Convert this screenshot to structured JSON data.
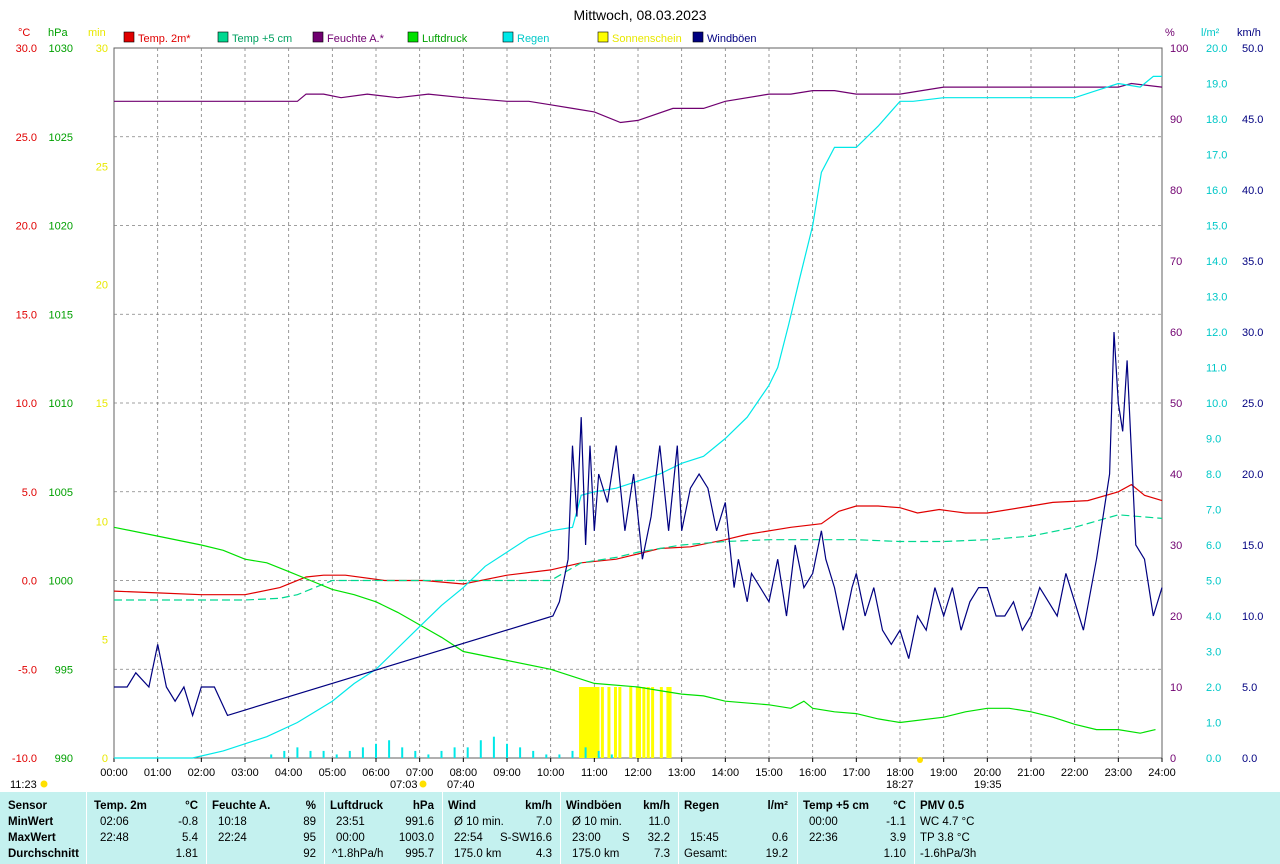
{
  "title": "Mittwoch, 08.03.2023",
  "legend": [
    {
      "label": "Temp. 2m*",
      "color": "#e00000",
      "label_color": "#e00000"
    },
    {
      "label": "Temp +5 cm",
      "color": "#00d890",
      "label_color": "#00a060"
    },
    {
      "label": "Feuchte A.*",
      "color": "#700070",
      "label_color": "#700070"
    },
    {
      "label": "Luftdruck",
      "color": "#00e000",
      "label_color": "#00a000"
    },
    {
      "label": "Regen",
      "color": "#00e8e8",
      "label_color": "#00c8c8"
    },
    {
      "label": "Sonnenschein",
      "color": "#ffff00",
      "label_color": "#e8e800"
    },
    {
      "label": "Windböen",
      "color": "#000080",
      "label_color": "#000080"
    }
  ],
  "axes": {
    "temp": {
      "unit": "°C",
      "min": -10,
      "max": 30,
      "ticks": [
        "30.0",
        "25.0",
        "20.0",
        "15.0",
        "10.0",
        "5.0",
        "0.0",
        "-5.0",
        "-10.0"
      ],
      "color": "#e00000"
    },
    "pressure": {
      "unit": "hPa",
      "min": 990,
      "max": 1030,
      "ticks": [
        "1030",
        "1025",
        "1020",
        "1015",
        "1010",
        "1005",
        "1000",
        "995",
        "990"
      ],
      "color": "#00a000"
    },
    "sunshine": {
      "unit": "min",
      "min": 0,
      "max": 30,
      "ticks": [
        "30",
        "25",
        "20",
        "15",
        "10",
        "5",
        "0"
      ],
      "color": "#e8e800"
    },
    "humidity": {
      "unit": "%",
      "min": 0,
      "max": 100,
      "ticks": [
        "100",
        "90",
        "80",
        "70",
        "60",
        "50",
        "40",
        "30",
        "20",
        "10",
        "0"
      ],
      "color": "#700070"
    },
    "rain": {
      "unit": "l/m²",
      "min": 0,
      "max": 20,
      "ticks": [
        "20.0",
        "19.0",
        "18.0",
        "17.0",
        "16.0",
        "15.0",
        "14.0",
        "13.0",
        "12.0",
        "11.0",
        "10.0",
        "9.0",
        "8.0",
        "7.0",
        "6.0",
        "5.0",
        "4.0",
        "3.0",
        "2.0",
        "1.0",
        "0.0"
      ],
      "color": "#00c8c8"
    },
    "wind": {
      "unit": "km/h",
      "min": 0,
      "max": 50,
      "ticks": [
        "50.0",
        "45.0",
        "40.0",
        "35.0",
        "30.0",
        "25.0",
        "20.0",
        "15.0",
        "10.0",
        "5.0",
        "0.0"
      ],
      "color": "#000080"
    },
    "time_ticks": [
      "00:00",
      "01:00",
      "02:00",
      "03:00",
      "04:00",
      "05:00",
      "06:00",
      "07:00",
      "08:00",
      "09:00",
      "10:00",
      "11:00",
      "12:00",
      "13:00",
      "14:00",
      "15:00",
      "16:00",
      "17:00",
      "18:00",
      "19:00",
      "20:00",
      "21:00",
      "22:00",
      "23:00",
      "24:00"
    ]
  },
  "sun_events": {
    "sunrise": "07:03",
    "sunrise_alt": "07:40",
    "sunset": "18:27",
    "sunset_alt": "19:35",
    "moon": "11:23"
  },
  "chart_data": {
    "type": "line",
    "x_unit": "hour of day",
    "xlim": [
      0,
      24
    ],
    "grid": true,
    "series": [
      {
        "name": "Temp. 2m*",
        "axis": "temp",
        "x": [
          0,
          1,
          2,
          3,
          3.8,
          4.4,
          4.8,
          5.3,
          6.2,
          7.1,
          8,
          9,
          10,
          10.7,
          11.5,
          12,
          12.5,
          13.2,
          14,
          14.5,
          15.5,
          16.2,
          16.6,
          17,
          17.5,
          18,
          18.4,
          18.9,
          19.2,
          19.5,
          20,
          21,
          21.5,
          22.3,
          23,
          23.3,
          23.6,
          24
        ],
        "y": [
          -0.6,
          -0.7,
          -0.8,
          -0.8,
          -0.4,
          0.2,
          0.3,
          0.3,
          0.0,
          0.0,
          -0.2,
          0.3,
          0.6,
          1.0,
          1.2,
          1.5,
          1.8,
          1.9,
          2.3,
          2.6,
          3.0,
          3.2,
          3.9,
          4.2,
          4.2,
          4.1,
          3.8,
          4.0,
          3.9,
          3.8,
          3.8,
          4.2,
          4.4,
          4.5,
          5.0,
          5.4,
          4.8,
          4.5
        ]
      },
      {
        "name": "Temp +5 cm",
        "axis": "temp",
        "x": [
          0,
          2,
          3,
          3.8,
          4.2,
          5,
          6,
          7,
          8,
          9,
          10,
          10.7,
          11.5,
          12,
          12.5,
          13,
          14,
          15,
          16,
          17,
          18,
          19,
          20,
          21,
          22,
          23,
          24
        ],
        "y": [
          -1.1,
          -1.1,
          -1.1,
          -1.0,
          -0.8,
          0.0,
          0.0,
          0.0,
          0.0,
          0.0,
          0.0,
          1.0,
          1.3,
          1.6,
          1.8,
          2.0,
          2.2,
          2.3,
          2.3,
          2.3,
          2.2,
          2.2,
          2.3,
          2.5,
          3.0,
          3.7,
          3.5
        ]
      },
      {
        "name": "Feuchte A.*",
        "axis": "humidity",
        "x": [
          0,
          4.2,
          4.4,
          4.8,
          5.2,
          5.8,
          6.5,
          7.2,
          8,
          9,
          9.5,
          10,
          10.5,
          11,
          11.6,
          12,
          12.8,
          13.5,
          14,
          15,
          15.5,
          16,
          16.5,
          17,
          18,
          18.5,
          19,
          20,
          21,
          22,
          23,
          23.3,
          24
        ],
        "y": [
          92.5,
          92.5,
          93.5,
          93.5,
          93,
          93.5,
          93,
          93.5,
          93,
          92.5,
          92.5,
          92,
          91.5,
          91,
          89.5,
          89.8,
          91.5,
          91.5,
          92.5,
          93.5,
          93.5,
          94,
          94,
          93.5,
          93.5,
          94,
          94.5,
          94.5,
          94.5,
          94.5,
          94.5,
          95,
          94.5
        ]
      },
      {
        "name": "Luftdruck",
        "axis": "pressure",
        "x": [
          0,
          1,
          2,
          2.5,
          3,
          3.5,
          4,
          4.5,
          5,
          5.5,
          6,
          6.5,
          7,
          7.5,
          8,
          9,
          10,
          11,
          12,
          12.5,
          13,
          13.5,
          14,
          15,
          15.5,
          15.8,
          16,
          16.5,
          17,
          17.5,
          18,
          19,
          19.5,
          20,
          20.5,
          21,
          21.5,
          22,
          22.5,
          23,
          23.5,
          23.85
        ],
        "y": [
          1003.0,
          1002.5,
          1002.0,
          1001.7,
          1001.2,
          1001.0,
          1000.5,
          1000.0,
          999.5,
          999.2,
          998.8,
          998.2,
          997.5,
          996.8,
          996.0,
          995.5,
          995.0,
          994.2,
          994.0,
          993.8,
          993.6,
          993.5,
          993.2,
          993.0,
          992.8,
          993.2,
          992.8,
          992.6,
          992.5,
          992.2,
          992.0,
          992.3,
          992.6,
          992.8,
          992.8,
          992.6,
          992.3,
          991.9,
          991.6,
          991.6,
          991.4,
          991.6
        ]
      },
      {
        "name": "Regen",
        "axis": "rain",
        "x": [
          0,
          1.8,
          2.5,
          3.5,
          4.2,
          5,
          5.5,
          6,
          6.5,
          7,
          7.5,
          8,
          8.5,
          9,
          9.5,
          10,
          10.5,
          10.7,
          11,
          11.5,
          12,
          12.5,
          13,
          13.5,
          14,
          14.5,
          15,
          15.2,
          15.45,
          15.7,
          16,
          16.2,
          16.5,
          17,
          17.5,
          18,
          18.3,
          19,
          20,
          21,
          22,
          22.5,
          23,
          23.5,
          23.8,
          24
        ],
        "y": [
          0,
          0,
          0.2,
          0.6,
          1.0,
          1.6,
          2.1,
          2.5,
          3.1,
          3.7,
          4.3,
          4.8,
          5.4,
          5.8,
          6.2,
          6.4,
          6.5,
          7.4,
          7.5,
          7.6,
          7.8,
          8.0,
          8.3,
          8.5,
          9.0,
          9.6,
          10.5,
          11.0,
          12.2,
          13.5,
          15.0,
          16.5,
          17.2,
          17.2,
          17.8,
          18.5,
          18.5,
          18.6,
          18.6,
          18.6,
          18.6,
          18.8,
          19.0,
          18.9,
          19.2,
          19.2
        ]
      },
      {
        "name": "Windböen",
        "axis": "wind",
        "x": [
          0,
          0.3,
          0.5,
          0.8,
          1.0,
          1.2,
          1.4,
          1.6,
          1.8,
          2.0,
          2.3,
          2.6,
          10.05,
          10.2,
          10.4,
          10.5,
          10.6,
          10.7,
          10.8,
          10.9,
          11.0,
          11.1,
          11.3,
          11.5,
          11.7,
          11.9,
          12.1,
          12.3,
          12.5,
          12.7,
          12.9,
          13.0,
          13.2,
          13.4,
          13.6,
          13.8,
          14.0,
          14.2,
          14.3,
          14.5,
          14.6,
          14.8,
          15.0,
          15.2,
          15.4,
          15.6,
          15.8,
          16.0,
          16.2,
          16.3,
          16.5,
          16.7,
          16.9,
          17.0,
          17.2,
          17.4,
          17.6,
          17.8,
          18.0,
          18.2,
          18.4,
          18.6,
          18.8,
          19.0,
          19.2,
          19.4,
          19.6,
          19.8,
          20.0,
          20.2,
          20.4,
          20.6,
          20.8,
          21.0,
          21.2,
          21.4,
          21.6,
          21.8,
          22.0,
          22.2,
          22.5,
          22.8,
          22.9,
          23.0,
          23.1,
          23.2,
          23.4,
          23.6,
          23.8,
          24.0
        ],
        "y": [
          5,
          5,
          6,
          5,
          8,
          5,
          4,
          5,
          3,
          5,
          5,
          3,
          10,
          11,
          14,
          22,
          17,
          24,
          15,
          22,
          16,
          20,
          18,
          22,
          16,
          20,
          14,
          17,
          22,
          16,
          22,
          16,
          19,
          20,
          19,
          16,
          18,
          12,
          14,
          11,
          13,
          12,
          11,
          14,
          10,
          15,
          12,
          13,
          16,
          14,
          12,
          9,
          12,
          13,
          10,
          12,
          9,
          8,
          9,
          7,
          10,
          9,
          12,
          10,
          12,
          9,
          11,
          12,
          12,
          10,
          10,
          11,
          9,
          10,
          12,
          11,
          10,
          13,
          11,
          9,
          14,
          20,
          30,
          25,
          23,
          28,
          15,
          14,
          10,
          12
        ]
      }
    ],
    "bars": {
      "name": "Sonnenschein",
      "axis": "sunshine",
      "x": [
        10.65,
        10.7,
        10.75,
        10.8,
        10.85,
        10.9,
        10.95,
        11.0,
        11.05,
        11.15,
        11.3,
        11.45,
        11.55,
        11.8,
        11.95,
        12.0,
        12.1,
        12.2,
        12.3,
        12.5,
        12.65,
        12.7
      ],
      "values": [
        3,
        3,
        3,
        3,
        3,
        3,
        3,
        3,
        3,
        3,
        3,
        3,
        3,
        3,
        3,
        3,
        3,
        3,
        3,
        3,
        3,
        3
      ]
    }
  },
  "summary": {
    "row_labels": [
      "Sensor",
      "MinWert",
      "MaxWert",
      "Durchschnitt"
    ],
    "temp2m": {
      "header": "Temp. 2m",
      "unit": "°C",
      "rows": [
        [
          "02:06",
          "-0.8"
        ],
        [
          "22:48",
          "5.4"
        ],
        [
          "",
          "1.81"
        ]
      ]
    },
    "humidity": {
      "header": "Feuchte A.",
      "unit": "%",
      "rows": [
        [
          "10:18",
          "89"
        ],
        [
          "22:24",
          "95"
        ],
        [
          "",
          "92"
        ]
      ]
    },
    "pressure": {
      "header": "Luftdruck",
      "unit": "hPa",
      "rows": [
        [
          "23:51",
          "991.6"
        ],
        [
          "00:00",
          "1003.0"
        ],
        [
          "^1.8hPa/h",
          "995.7"
        ]
      ]
    },
    "wind": {
      "header": "Wind",
      "unit": "km/h",
      "rows": [
        [
          "Ø 10 min.",
          "",
          "7.0"
        ],
        [
          "22:54",
          "S-SW",
          "16.6"
        ],
        [
          "175.0 km",
          "",
          "4.3"
        ]
      ]
    },
    "gusts": {
      "header": "Windböen",
      "unit": "km/h",
      "rows": [
        [
          "Ø 10 min.",
          "",
          "11.0"
        ],
        [
          "23:00",
          "S",
          "32.2"
        ],
        [
          "175.0 km",
          "",
          "7.3"
        ]
      ]
    },
    "rain": {
      "header": "Regen",
      "unit": "l/m²",
      "rows": [
        [
          "",
          ""
        ],
        [
          "15:45",
          "0.6"
        ],
        [
          "Gesamt:",
          "19.2"
        ]
      ]
    },
    "temp5cm": {
      "header": "Temp +5 cm",
      "unit": "°C",
      "rows": [
        [
          "00:00",
          "-1.1"
        ],
        [
          "22:36",
          "3.9"
        ],
        [
          "",
          "1.10"
        ]
      ]
    },
    "pmv": {
      "header": "PMV 0.5",
      "rows": [
        "WC 4.7 °C",
        "TP 3.8 °C",
        "-1.6hPa/3h"
      ]
    }
  }
}
